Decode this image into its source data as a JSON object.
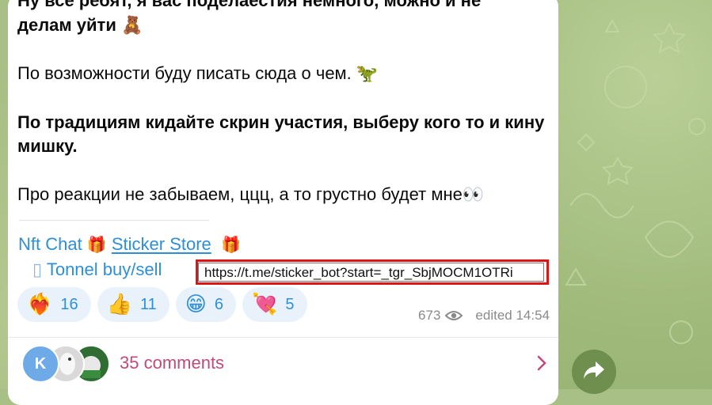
{
  "message": {
    "line_partial_top": "Ну все ребят, я вас поделаестия немного, можно и не",
    "line_partial_top_2": "делам уйти",
    "line_partial_top_2_emoji": "🧸",
    "paragraph_2": "По возможности буду писать сюда о чем.",
    "paragraph_2_emoji": "🦖",
    "paragraph_3": "По традициям кидайте скрин участия, выберу кого то и кину мишку.",
    "paragraph_4": "Про реакции не забываем, ццц, а то грустно будет мне",
    "paragraph_4_emoji": "👀"
  },
  "links": {
    "nft_chat": "Nft Chat",
    "sticker_store": "Sticker Store",
    "tonnel": "Tonnel buy/sell",
    "gift_icon": "gift-icon",
    "tonnel_icon": "tonnel-icon"
  },
  "tooltip": {
    "url": "https://t.me/sticker_bot?start=_tgr_SbjMOCM1OTRi"
  },
  "reactions": [
    {
      "emoji": "❤️‍🔥",
      "count": "16"
    },
    {
      "emoji": "👍",
      "count": "11"
    },
    {
      "emoji": "😁",
      "count": "6"
    },
    {
      "emoji": "💘",
      "count": "5"
    }
  ],
  "meta": {
    "views": "673",
    "edited": "edited 14:54"
  },
  "comments": {
    "avatar_letter": "K",
    "label": "35 comments"
  },
  "colors": {
    "link": "#2d8fd9",
    "comments": "#c04a7a",
    "tooltip_border": "#e01414"
  }
}
